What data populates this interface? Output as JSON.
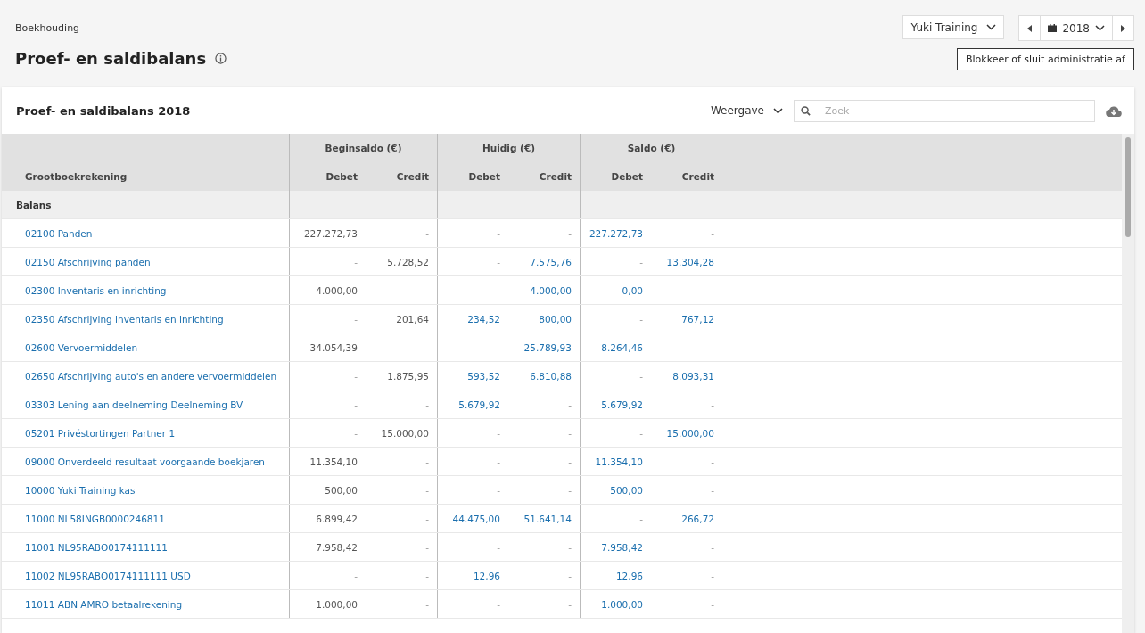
{
  "breadcrumb": "Boekhouding",
  "title": "Proef- en saldibalans",
  "company_select": "Yuki Training",
  "year_select": "2018",
  "tooltip": "Blokkeer of sluit administratie af",
  "panel": {
    "title": "Proef- en saldibalans 2018",
    "view_menu": "Weergave",
    "search": {
      "placeholder": "Zoek"
    }
  },
  "table": {
    "account_header": "Grootboekrekening",
    "groups": [
      {
        "label": "Beginsaldo (€)",
        "columns": [
          "Debet",
          "Credit"
        ]
      },
      {
        "label": "Huidig (€)",
        "columns": [
          "Debet",
          "Credit"
        ]
      },
      {
        "label": "Saldo (€)",
        "columns": [
          "Debet",
          "Credit"
        ]
      }
    ],
    "section": "Balans",
    "rows": [
      {
        "account": "02100 Panden",
        "values": [
          {
            "text": "227.272,73",
            "linked": false
          },
          {
            "text": "-",
            "linked": false
          },
          {
            "text": "-",
            "linked": false
          },
          {
            "text": "-",
            "linked": false
          },
          {
            "text": "227.272,73",
            "linked": true
          },
          {
            "text": "-",
            "linked": false
          }
        ]
      },
      {
        "account": "02150 Afschrijving panden",
        "values": [
          {
            "text": "-",
            "linked": false
          },
          {
            "text": "5.728,52",
            "linked": false
          },
          {
            "text": "-",
            "linked": false
          },
          {
            "text": "7.575,76",
            "linked": true
          },
          {
            "text": "-",
            "linked": false
          },
          {
            "text": "13.304,28",
            "linked": true
          }
        ]
      },
      {
        "account": "02300 Inventaris en inrichting",
        "values": [
          {
            "text": "4.000,00",
            "linked": false
          },
          {
            "text": "-",
            "linked": false
          },
          {
            "text": "-",
            "linked": false
          },
          {
            "text": "4.000,00",
            "linked": true
          },
          {
            "text": "0,00",
            "linked": true
          },
          {
            "text": "-",
            "linked": false
          }
        ]
      },
      {
        "account": "02350 Afschrijving inventaris en inrichting",
        "values": [
          {
            "text": "-",
            "linked": false
          },
          {
            "text": "201,64",
            "linked": false
          },
          {
            "text": "234,52",
            "linked": true
          },
          {
            "text": "800,00",
            "linked": true
          },
          {
            "text": "-",
            "linked": false
          },
          {
            "text": "767,12",
            "linked": true
          }
        ]
      },
      {
        "account": "02600 Vervoermiddelen",
        "values": [
          {
            "text": "34.054,39",
            "linked": false
          },
          {
            "text": "-",
            "linked": false
          },
          {
            "text": "-",
            "linked": false
          },
          {
            "text": "25.789,93",
            "linked": true
          },
          {
            "text": "8.264,46",
            "linked": true
          },
          {
            "text": "-",
            "linked": false
          }
        ]
      },
      {
        "account": "02650 Afschrijving auto's en andere vervoermiddelen",
        "values": [
          {
            "text": "-",
            "linked": false
          },
          {
            "text": "1.875,95",
            "linked": false
          },
          {
            "text": "593,52",
            "linked": true
          },
          {
            "text": "6.810,88",
            "linked": true
          },
          {
            "text": "-",
            "linked": false
          },
          {
            "text": "8.093,31",
            "linked": true
          }
        ]
      },
      {
        "account": "03303 Lening aan deelneming Deelneming BV",
        "values": [
          {
            "text": "-",
            "linked": false
          },
          {
            "text": "-",
            "linked": false
          },
          {
            "text": "5.679,92",
            "linked": true
          },
          {
            "text": "-",
            "linked": false
          },
          {
            "text": "5.679,92",
            "linked": true
          },
          {
            "text": "-",
            "linked": false
          }
        ]
      },
      {
        "account": "05201 Privéstortingen Partner 1",
        "values": [
          {
            "text": "-",
            "linked": false
          },
          {
            "text": "15.000,00",
            "linked": false
          },
          {
            "text": "-",
            "linked": false
          },
          {
            "text": "-",
            "linked": false
          },
          {
            "text": "-",
            "linked": false
          },
          {
            "text": "15.000,00",
            "linked": true
          }
        ]
      },
      {
        "account": "09000 Onverdeeld resultaat voorgaande boekjaren",
        "values": [
          {
            "text": "11.354,10",
            "linked": false
          },
          {
            "text": "-",
            "linked": false
          },
          {
            "text": "-",
            "linked": false
          },
          {
            "text": "-",
            "linked": false
          },
          {
            "text": "11.354,10",
            "linked": true
          },
          {
            "text": "-",
            "linked": false
          }
        ]
      },
      {
        "account": "10000 Yuki Training kas",
        "values": [
          {
            "text": "500,00",
            "linked": false
          },
          {
            "text": "-",
            "linked": false
          },
          {
            "text": "-",
            "linked": false
          },
          {
            "text": "-",
            "linked": false
          },
          {
            "text": "500,00",
            "linked": true
          },
          {
            "text": "-",
            "linked": false
          }
        ]
      },
      {
        "account": "11000 NL58INGB0000246811",
        "values": [
          {
            "text": "6.899,42",
            "linked": false
          },
          {
            "text": "-",
            "linked": false
          },
          {
            "text": "44.475,00",
            "linked": true
          },
          {
            "text": "51.641,14",
            "linked": true
          },
          {
            "text": "-",
            "linked": false
          },
          {
            "text": "266,72",
            "linked": true
          }
        ]
      },
      {
        "account": "11001 NL95RABO0174111111",
        "values": [
          {
            "text": "7.958,42",
            "linked": false
          },
          {
            "text": "-",
            "linked": false
          },
          {
            "text": "-",
            "linked": false
          },
          {
            "text": "-",
            "linked": false
          },
          {
            "text": "7.958,42",
            "linked": true
          },
          {
            "text": "-",
            "linked": false
          }
        ]
      },
      {
        "account": "11002 NL95RABO0174111111 USD",
        "values": [
          {
            "text": "-",
            "linked": false
          },
          {
            "text": "-",
            "linked": false
          },
          {
            "text": "12,96",
            "linked": true
          },
          {
            "text": "-",
            "linked": false
          },
          {
            "text": "12,96",
            "linked": true
          },
          {
            "text": "-",
            "linked": false
          }
        ]
      },
      {
        "account": "11011 ABN AMRO betaalrekening",
        "values": [
          {
            "text": "1.000,00",
            "linked": false
          },
          {
            "text": "-",
            "linked": false
          },
          {
            "text": "-",
            "linked": false
          },
          {
            "text": "-",
            "linked": false
          },
          {
            "text": "1.000,00",
            "linked": true
          },
          {
            "text": "-",
            "linked": false
          }
        ]
      }
    ]
  }
}
